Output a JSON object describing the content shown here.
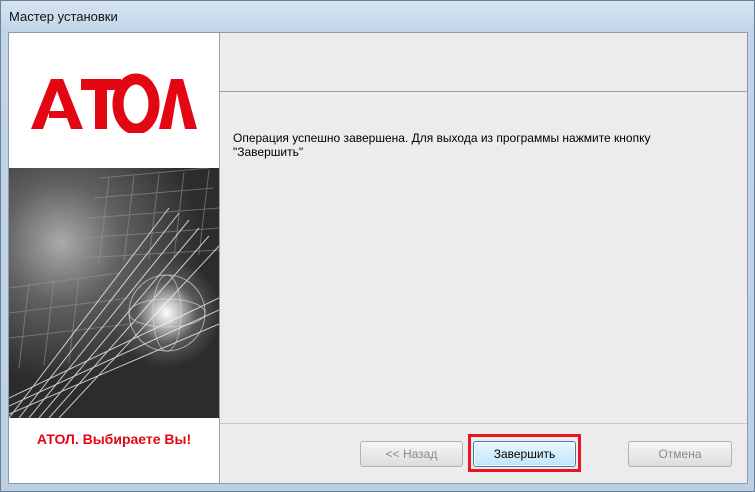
{
  "window": {
    "title": "Мастер установки"
  },
  "sidebar": {
    "logo_text": "АТОЛ",
    "slogan": "АТОЛ. Выбираете Вы!"
  },
  "main": {
    "message": "Операция успешно завершена. Для выхода из программы нажмите кнопку \"Завершить\""
  },
  "buttons": {
    "back": "<< Назад",
    "finish": "Завершить",
    "cancel": "Отмена"
  },
  "colors": {
    "brand_red": "#e30613",
    "highlight": "#e8141e"
  }
}
